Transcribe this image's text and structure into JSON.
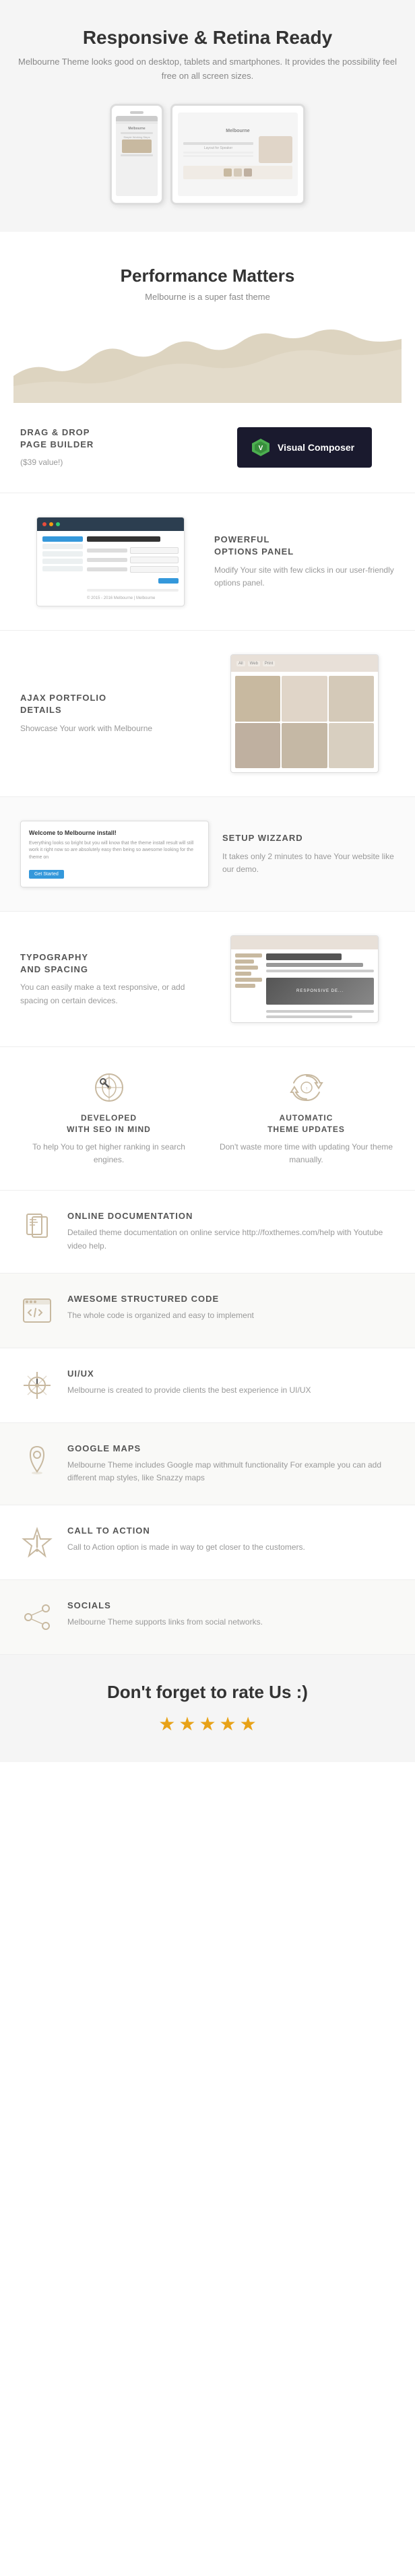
{
  "section_responsive": {
    "title": "Responsive  & Retina Ready",
    "description": "Melbourne Theme looks good on desktop, tablets and smartphones. It provides the possibility feel free on all screen sizes."
  },
  "section_performance": {
    "title": "Performance Matters",
    "description": "Melbourne is a super fast theme"
  },
  "section_drag_drop": {
    "label": "DRAG & DROP\nPAGE BUILDER",
    "sublabel": "($39 value!)",
    "vc_label": "Visual Composer"
  },
  "section_options": {
    "label": "POWERFUL\nOPTIONS PANEL",
    "description": "Modify Your site with few clicks in our user-friendly options panel."
  },
  "section_ajax": {
    "label": "AJAX PORTFOLIO\nDETAILS",
    "description": "Showcase Your work with Melbourne"
  },
  "section_setup": {
    "label": "SETUP WIZZARD",
    "description": "It takes only 2 minutes to have Your website like our demo.",
    "wizard_title": "Welcome to Melbourne install!",
    "wizard_text": "Everything looks so bright but you will know that the theme install result will still work it right now so are absolutely easy then being so awesome looking for the theme on"
  },
  "section_typography": {
    "label": "TYPOGRAPHY\nAND SPACING",
    "description": "You can easily make a text responsive, or add spacing on certain devices.",
    "image_text": "RESPONSIVE DE..."
  },
  "section_seo": {
    "label": "DEVELOPED\nWITH SEO IN MIND",
    "description": "To help You to get higher ranking in search engines."
  },
  "section_updates": {
    "label": "AUTOMATIC\nTHEME UPDATES",
    "description": "Don't waste more time with updating Your theme manually."
  },
  "section_docs": {
    "label": "ONLINE DOCUMENTATION",
    "description": "Detailed theme documentation on online service http://foxthemes.com/help with Youtube video help."
  },
  "section_code": {
    "label": "AWESOME STRUCTURED CODE",
    "description": "The whole code is organized and easy to implement"
  },
  "section_uiux": {
    "label": "UI/UX",
    "description": "Melbourne is created to provide clients the best experience in UI/UX"
  },
  "section_maps": {
    "label": "GOOGLE MAPS",
    "description": "Melbourne Theme includes Google map withmult functionality For example you can add different map styles, like Snazzy maps"
  },
  "section_cta": {
    "label": "CALL TO ACTION",
    "description": "Call to Action option is made in way to get closer to the customers."
  },
  "section_socials": {
    "label": "SOCIALS",
    "description": "Melbourne Theme supports links from social networks."
  },
  "section_rate": {
    "title": "Don't forget to rate Us :)",
    "stars": [
      "★",
      "★",
      "★",
      "★",
      "★"
    ]
  }
}
